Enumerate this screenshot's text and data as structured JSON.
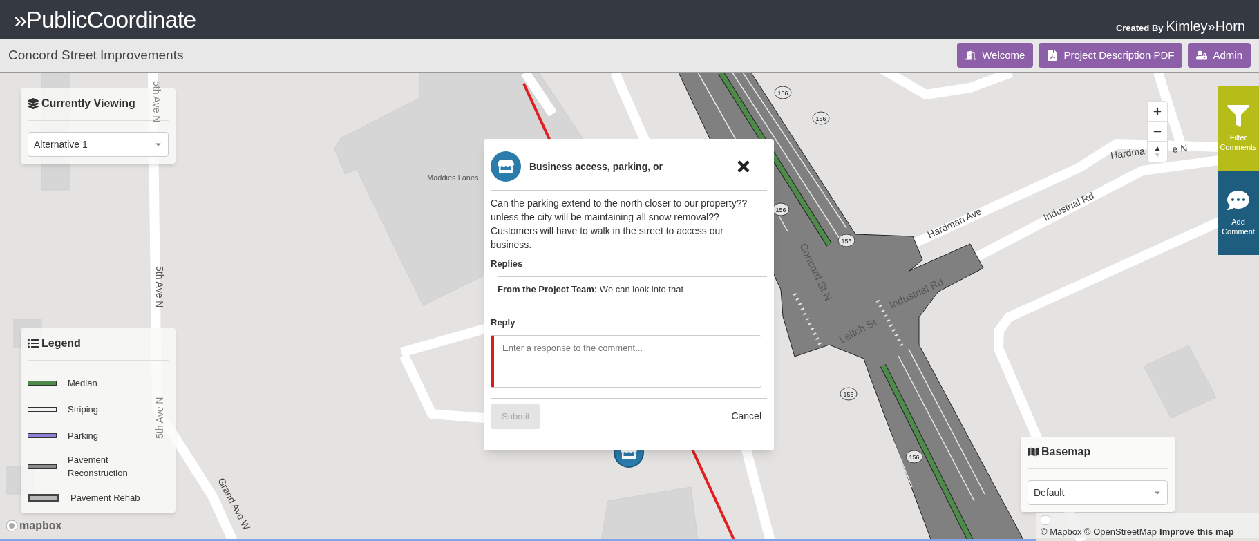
{
  "header": {
    "logo": "»PublicCoordinate",
    "credit_prefix": "Created By",
    "credit_brand": "Kimley»Horn"
  },
  "subheader": {
    "title": "Concord Street Improvements",
    "buttons": [
      {
        "label": "Welcome",
        "kind": "welcome"
      },
      {
        "label": "Project Description PDF",
        "kind": "pdf"
      },
      {
        "label": "Admin",
        "kind": "admin"
      }
    ]
  },
  "currently_viewing": {
    "title": "Currently Viewing",
    "value": "Alternative 1"
  },
  "legend": {
    "title": "Legend",
    "items": [
      {
        "label": "Median",
        "color": "#4e8a4a",
        "kind": "bar"
      },
      {
        "label": "Striping",
        "color": "#f1f1f1",
        "kind": "bar"
      },
      {
        "label": "Parking",
        "color": "#8f7fd6",
        "kind": "bar"
      },
      {
        "label": "Pavement Reconstruction",
        "color": "#8a8a8a",
        "kind": "bar"
      },
      {
        "label": "Pavement Rehab",
        "color": "#b9b9b9",
        "kind": "outlined"
      }
    ]
  },
  "map": {
    "labels": [
      {
        "text": "5th Ave N",
        "kind": "street"
      },
      {
        "text": "5th Ave N",
        "kind": "street"
      },
      {
        "text": "5th Ave N",
        "kind": "street"
      },
      {
        "text": "Maddies Lanes",
        "kind": "place"
      },
      {
        "text": "Grand Ave W",
        "kind": "street"
      },
      {
        "text": "Hardman Ave",
        "kind": "street"
      },
      {
        "text": "Hardma",
        "kind": "street"
      },
      {
        "text": "e N",
        "kind": "street"
      },
      {
        "text": "Industrial Rd",
        "kind": "street"
      },
      {
        "text": "Concord St N",
        "kind": "road"
      },
      {
        "text": "Leitch St",
        "kind": "road"
      },
      {
        "text": "Industrial Rd",
        "kind": "road"
      }
    ],
    "shields": [
      "156",
      "156",
      "156",
      "156",
      "156",
      "156"
    ]
  },
  "popup": {
    "title": "Business access, parking, or",
    "comment": "Can the parking extend to the north closer to our property?? unless the city will be maintaining all snow removal?? Customers will have to walk in the street to access our business.",
    "replies_heading": "Replies",
    "replies": [
      "**From the Project Team:** We can look into that"
    ],
    "reply_label": "Reply",
    "reply_field": {
      "placeholder": "Enter a response to the comment...",
      "invalid": true
    },
    "submit": {
      "label": "Submit",
      "disabled": true
    },
    "cancel": "Cancel"
  },
  "side_buttons": [
    {
      "label": "Filter Comments",
      "kind": "filter"
    },
    {
      "label": "Add Comment",
      "kind": "comment"
    }
  ],
  "basemap": {
    "title": "Basemap",
    "value": "Default"
  },
  "attribution": {
    "checkbox": {
      "checked": false
    },
    "text": "© Mapbox © OpenStreetMap",
    "link": "Improve this map"
  },
  "mapbox_logo": "mapbox"
}
